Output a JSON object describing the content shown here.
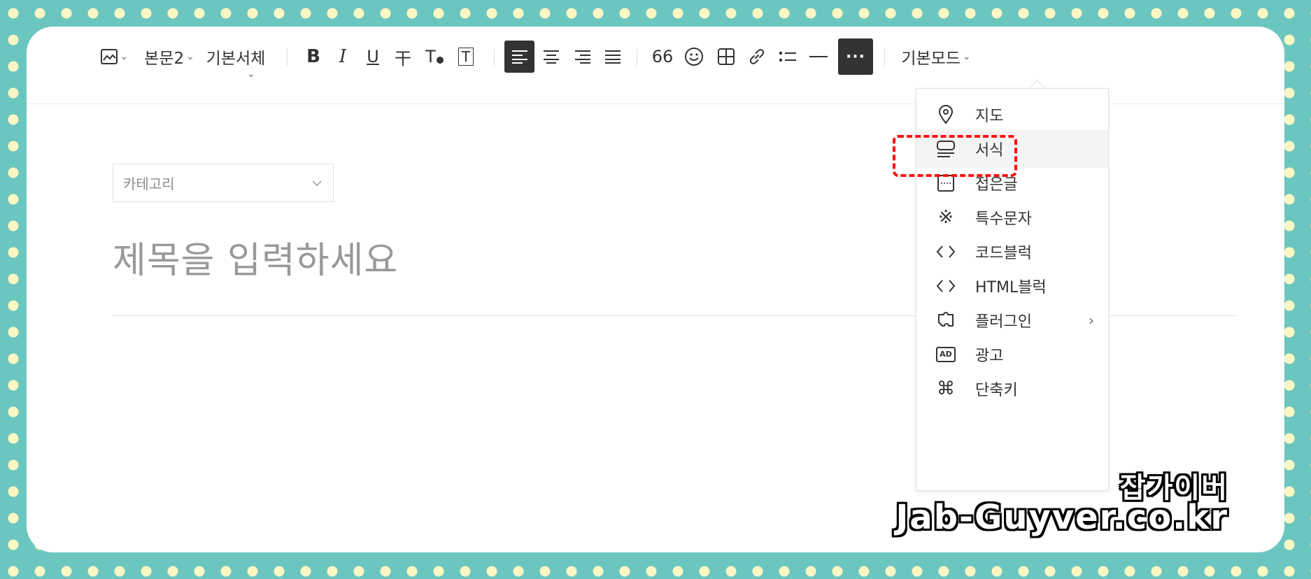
{
  "toolbar": {
    "paragraph_style": "본문2",
    "font": "기본서체",
    "bold": "B",
    "italic": "I",
    "underline": "U",
    "strike": "干",
    "text_color": "T",
    "text_bg": "T",
    "quote": "66",
    "mode": "기본모드",
    "more": "···"
  },
  "editor": {
    "category_placeholder": "카테고리",
    "title_placeholder": "제목을 입력하세요"
  },
  "more_menu": {
    "items": [
      {
        "label": "지도",
        "icon": "map-pin-icon"
      },
      {
        "label": "서식",
        "icon": "template-icon"
      },
      {
        "label": "접은글",
        "icon": "fold-icon"
      },
      {
        "label": "특수문자",
        "icon": "special-char-icon"
      },
      {
        "label": "코드블럭",
        "icon": "code-icon"
      },
      {
        "label": "HTML블럭",
        "icon": "html-icon"
      },
      {
        "label": "플러그인",
        "icon": "plugin-icon"
      },
      {
        "label": "광고",
        "icon": "ad-icon",
        "icon_text": "AD"
      },
      {
        "label": "단축키",
        "icon": "command-icon",
        "icon_text": "⌘"
      }
    ],
    "plugin_arrow": "›",
    "special_char_glyph": "※",
    "code_glyph": "<>"
  },
  "watermark": {
    "line1": "잡가이버",
    "line2": "Jab-Guyver.co.kr"
  },
  "colors": {
    "background": "#6cc6c0",
    "dots": "#fbf7c4",
    "highlight": "#ff1010",
    "active_button": "#333333"
  }
}
